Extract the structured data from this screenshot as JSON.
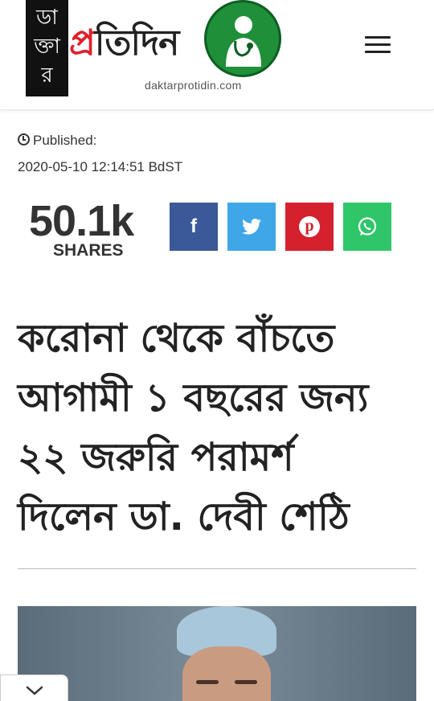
{
  "header": {
    "logo_left_chars": [
      "ডা",
      "ক্তা",
      "র"
    ],
    "logo_red": "প্র",
    "logo_dark": "তিদিন",
    "logo_url": "daktarprotidin.com"
  },
  "meta": {
    "published_label": "Published:",
    "published_date": "2020-05-10 12:14:51 BdST"
  },
  "shares": {
    "count": "50.1k",
    "label": "SHARES"
  },
  "social": {
    "facebook_glyph": "f",
    "pinterest_glyph": "p"
  },
  "article": {
    "title_lines": [
      "করোনা থেকে বাঁচতে",
      "আগামী ১ বছরের জন্য",
      "২২ জরুরি পরামর্শ",
      "দিলেন ডা. দেবী শেঠি"
    ]
  }
}
